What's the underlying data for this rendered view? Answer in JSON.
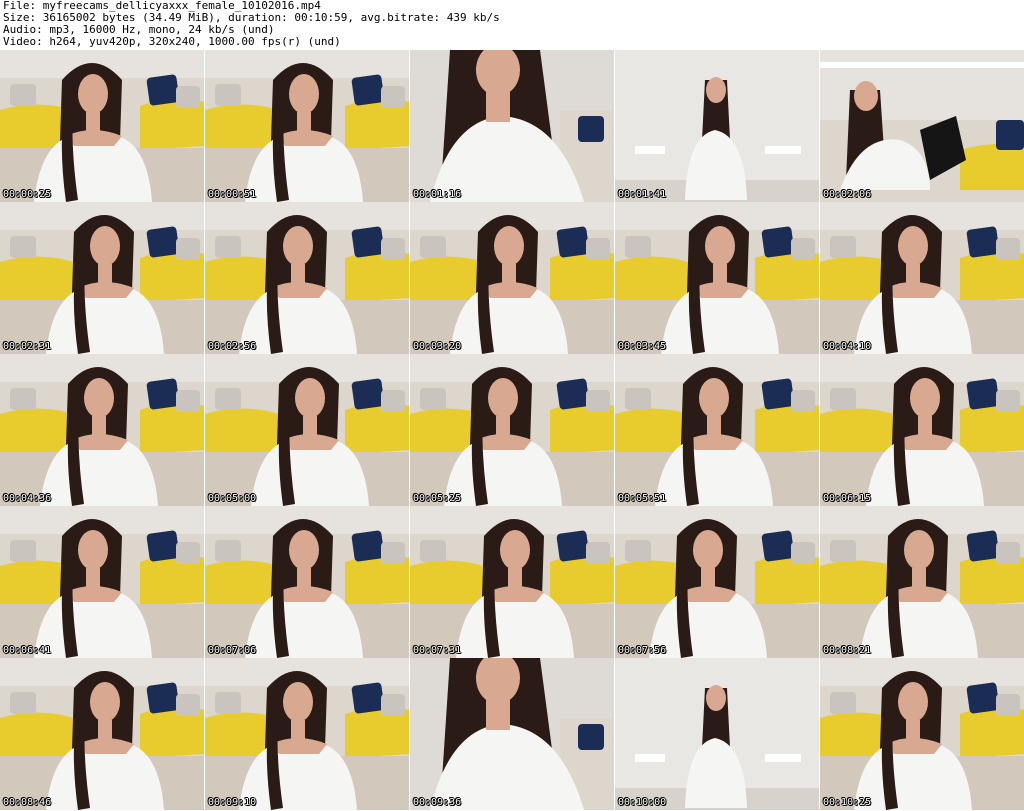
{
  "header": {
    "file_line": "File: myfreecams_dellicyaxxx_female_10102016.mp4",
    "size_line": "Size: 36165002 bytes (34.49 MiB), duration: 00:10:59, avg.bitrate: 439 kb/s",
    "audio_line": "Audio: mp3, 16000 Hz, mono, 24 kb/s (und)",
    "video_line": "Video: h264, yuv420p, 320x240, 1000.00 fps(r) (und)"
  },
  "colors": {
    "wall": "#e6e3df",
    "sofa": "#ddd6cc",
    "throw": "#e8cc2e",
    "pillow": "#1b2d55",
    "shirt": "#f5f5f3",
    "skin": "#d9a890",
    "hair": "#2a1b16",
    "floor": "#d2c9bc"
  },
  "thumbnails": [
    {
      "time": "00:00:25",
      "scene": "sofa"
    },
    {
      "time": "00:00:51",
      "scene": "sofa"
    },
    {
      "time": "00:01:16",
      "scene": "closeup"
    },
    {
      "time": "00:01:41",
      "scene": "standing"
    },
    {
      "time": "00:02:06",
      "scene": "lying"
    },
    {
      "time": "00:02:31",
      "scene": "sofa"
    },
    {
      "time": "00:02:56",
      "scene": "sofa"
    },
    {
      "time": "00:03:20",
      "scene": "sofa"
    },
    {
      "time": "00:03:45",
      "scene": "sofa"
    },
    {
      "time": "00:04:10",
      "scene": "sofa"
    },
    {
      "time": "00:04:36",
      "scene": "sofa"
    },
    {
      "time": "00:05:00",
      "scene": "sofa"
    },
    {
      "time": "00:05:25",
      "scene": "sofa"
    },
    {
      "time": "00:05:51",
      "scene": "sofa"
    },
    {
      "time": "00:06:15",
      "scene": "sofa"
    },
    {
      "time": "00:06:41",
      "scene": "sofa"
    },
    {
      "time": "00:07:06",
      "scene": "sofa"
    },
    {
      "time": "00:07:31",
      "scene": "sofa"
    },
    {
      "time": "00:07:56",
      "scene": "sofa"
    },
    {
      "time": "00:08:21",
      "scene": "sofa"
    },
    {
      "time": "00:08:46",
      "scene": "sofa"
    },
    {
      "time": "00:09:10",
      "scene": "sofa"
    },
    {
      "time": "00:09:36",
      "scene": "closeup"
    },
    {
      "time": "00:10:00",
      "scene": "standing"
    },
    {
      "time": "00:10:25",
      "scene": "sofa"
    }
  ]
}
